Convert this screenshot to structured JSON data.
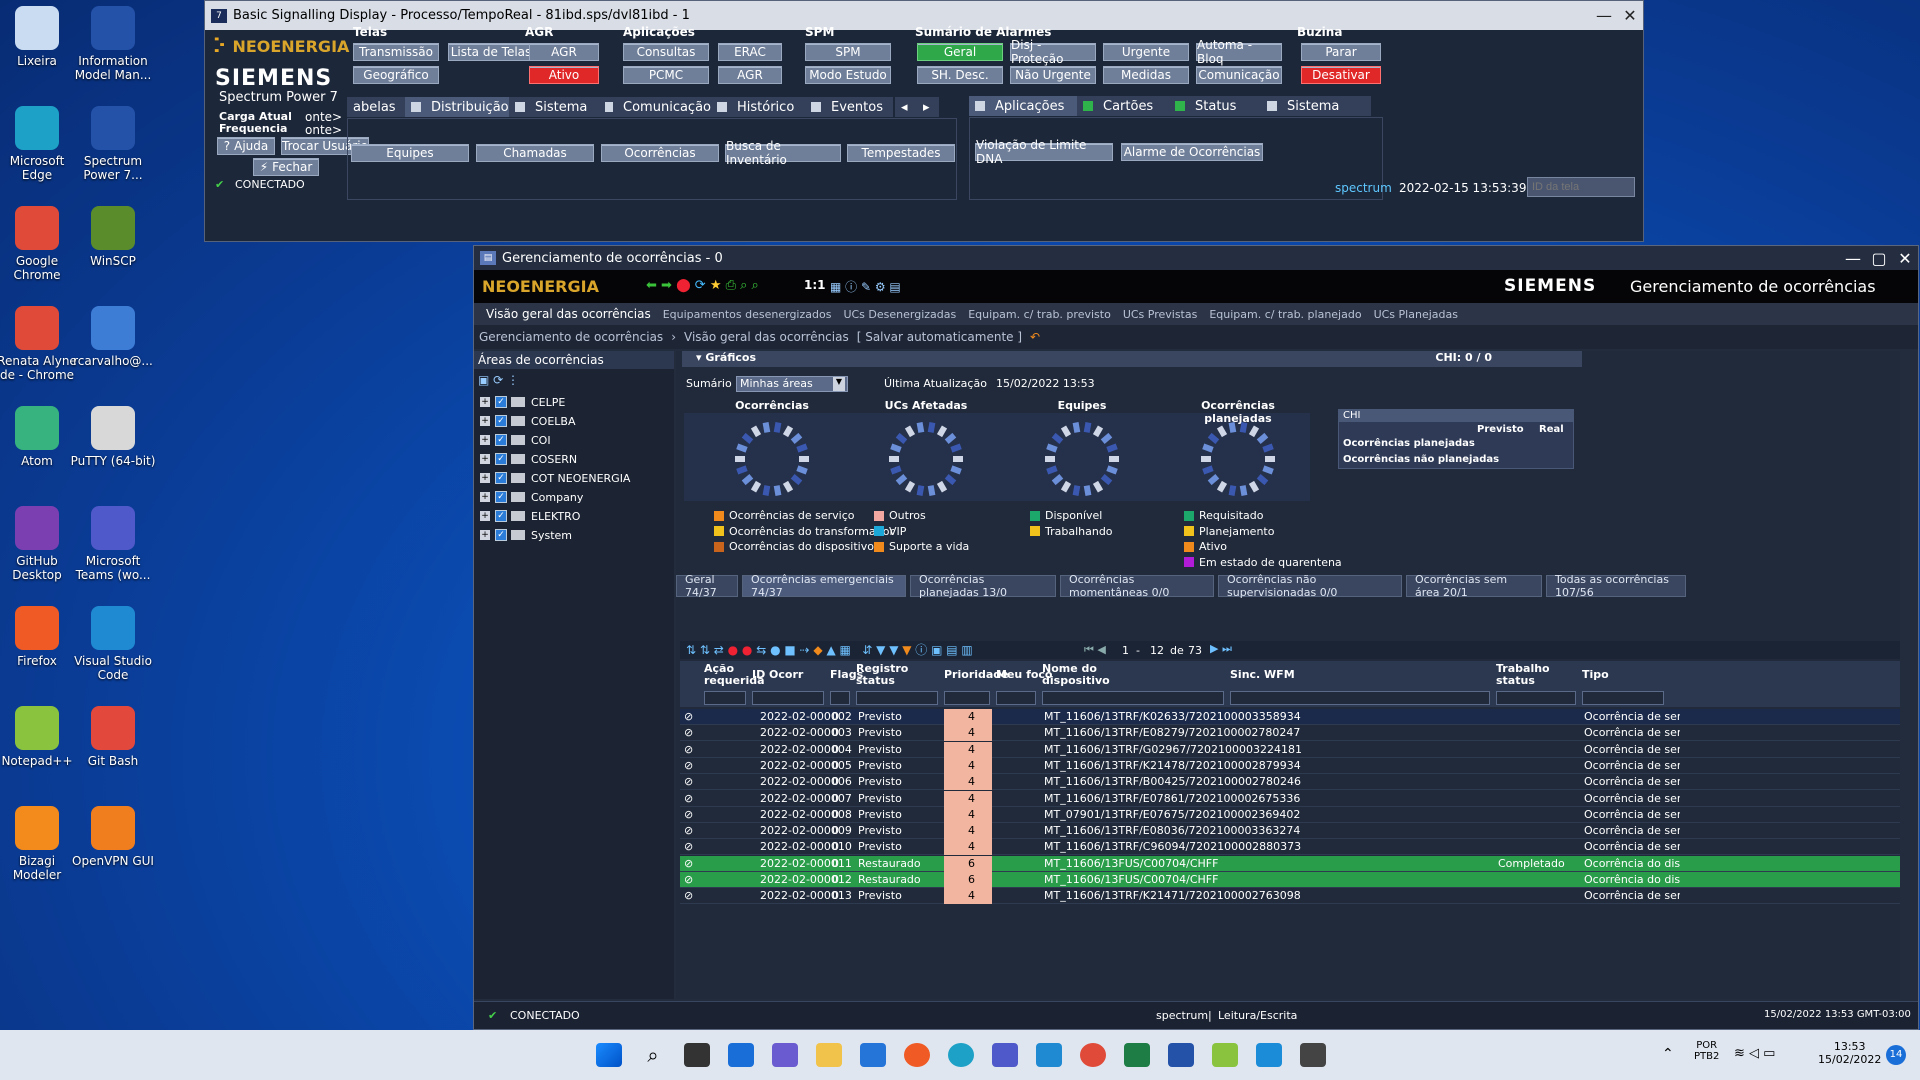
{
  "desktop": {
    "icons": [
      {
        "label": "Lixeira",
        "color": "#c9dcf2"
      },
      {
        "label": "Information Model Man...",
        "color": "#2452a8"
      },
      {
        "label": "Microsoft Edge",
        "color": "#1da1c6"
      },
      {
        "label": "Spectrum Power 7...",
        "color": "#2452a8"
      },
      {
        "label": "Google Chrome",
        "color": "#e04a38"
      },
      {
        "label": "WinSCP",
        "color": "#5a8c2c"
      },
      {
        "label": "Renata Alyne de - Chrome",
        "color": "#e04a38"
      },
      {
        "label": "rcarvalho@...",
        "color": "#3d7dd6"
      },
      {
        "label": "Atom",
        "color": "#36b37e"
      },
      {
        "label": "PuTTY (64-bit)",
        "color": "#d8d8d8"
      },
      {
        "label": "GitHub Desktop",
        "color": "#7b3fb2"
      },
      {
        "label": "Microsoft Teams (wo...",
        "color": "#5059c9"
      },
      {
        "label": "Firefox",
        "color": "#f05a24"
      },
      {
        "label": "Visual Studio Code",
        "color": "#1f8ad2"
      },
      {
        "label": "Notepad++",
        "color": "#8ac43f"
      },
      {
        "label": "Git Bash",
        "color": "#e2483b"
      },
      {
        "label": "Bizagi Modeler",
        "color": "#f28a1c"
      },
      {
        "label": "OpenVPN GUI",
        "color": "#f07e1f"
      }
    ]
  },
  "bsd": {
    "title": "Basic Signalling Display - Processo/TempoReal - 81ibd.sps/dvl81ibd - 1",
    "brand": "NEOENERGIA",
    "siemens": "SIEMENS",
    "product": "Spectrum Power 7",
    "carga": "Carga Atual",
    "freq": "Frequencia",
    "onte1": "onte>",
    "onte2": "onte>",
    "ajuda": "Ajuda",
    "trocar": "Trocar Usuário",
    "fechar": "Fechar",
    "telas": {
      "title": "Telas",
      "b1": "Transmissão",
      "b2": "Lista de Telas",
      "b3": "Geográfico"
    },
    "agr": {
      "title": "AGR",
      "b1": "AGR",
      "b2": "Ativo"
    },
    "aplic": {
      "title": "Aplicações",
      "b1": "Consultas",
      "b2": "ERAC",
      "b3": "PCMC",
      "b4": "AGR"
    },
    "spm": {
      "title": "SPM",
      "b1": "SPM",
      "b2": "Modo Estudo"
    },
    "alarmes": {
      "title": "Sumário de Alarmes",
      "b1": "Geral",
      "b2": "Disj - Proteção",
      "b3": "Urgente",
      "b4": "Automa - Bloq",
      "b5": "SH. Desc.",
      "b6": "Não Urgente",
      "b7": "Medidas",
      "b8": "Comunicação"
    },
    "buzina": {
      "title": "Buzina",
      "b1": "Parar",
      "b2": "Desativar"
    },
    "tabs": [
      "abelas",
      "Distribuição",
      "Sistema",
      "Comunicação",
      "Histórico",
      "Eventos"
    ],
    "tabs_right": [
      "Aplicações",
      "Cartões",
      "Status",
      "Sistema"
    ],
    "sub": [
      "Equipes",
      "Chamadas",
      "Ocorrências",
      "Busca de Inventário",
      "Tempestades"
    ],
    "sub_right": [
      "Violação de Limite DNA",
      "Alarme de Ocorrências"
    ],
    "status": "CONECTADO",
    "user": "spectrum",
    "datetime": "2022-02-15 13:53:39",
    "id_placeholder": "ID da tela"
  },
  "gdo": {
    "title": "Gerenciamento de ocorrências - 0",
    "brand": "NEOENERGIA",
    "siemens": "SIEMENS",
    "app": "Gerenciamento de ocorrências",
    "zoom": "1:1",
    "nav": [
      "Visão geral das ocorrências",
      "Equipamentos desenergizados",
      "UCs Desenergizadas",
      "Equipam. c/ trab. previsto",
      "UCs Previstas",
      "Equipam. c/ trab. planejado",
      "UCs Planejadas"
    ],
    "crumb1": "Gerenciamento de ocorrências",
    "crumb2": "Visão geral das ocorrências",
    "crumb3": "[ Salvar automaticamente ]",
    "areas_title": "Áreas de ocorrências",
    "areas": [
      "CELPE",
      "COELBA",
      "COI",
      "COSERN",
      "COT NEOENERGIA",
      "Company",
      "ELEKTRO",
      "System"
    ],
    "graficos": "Gráficos",
    "chi_count": "CHI: 0 / 0",
    "sumario": "Sumário",
    "sumario_value": "Minhas áreas",
    "ultima": "Última Atualização",
    "ultima_value": "15/02/2022 13:53",
    "charts": [
      "Ocorrências",
      "UCs Afetadas",
      "Equipes",
      "Ocorrências planejadas"
    ],
    "chi": {
      "title": "CHI",
      "previsto": "Previsto",
      "real": "Real",
      "r1": "Ocorrências planejadas",
      "r2": "Ocorrências não planejadas"
    },
    "legend1": [
      {
        "t": "Ocorrências de serviço",
        "c": "#f08a1c"
      },
      {
        "t": "Ocorrências do transformador",
        "c": "#f2c21c"
      },
      {
        "t": "Ocorrências do dispositivo",
        "c": "#c8641c"
      }
    ],
    "legend2": [
      {
        "t": "Outros",
        "c": "#f2a8a0"
      },
      {
        "t": "VIP",
        "c": "#1ca8d8"
      },
      {
        "t": "Suporte a vida",
        "c": "#f08a1c"
      }
    ],
    "legend3": [
      {
        "t": "Disponível",
        "c": "#1ca86a"
      },
      {
        "t": "Trabalhando",
        "c": "#f2c21c"
      }
    ],
    "legend4": [
      {
        "t": "Requisitado",
        "c": "#1ca86a"
      },
      {
        "t": "Planejamento",
        "c": "#f2c21c"
      },
      {
        "t": "Ativo",
        "c": "#f08a1c"
      },
      {
        "t": "Em estado de quarentena",
        "c": "#b21cd8"
      }
    ],
    "tabs": [
      "Geral 74/37",
      "Ocorrências emergenciais 74/37",
      "Ocorrências planejadas 13/0",
      "Ocorrências momentâneas 0/0",
      "Ocorrências não supervisionadas 0/0",
      "Ocorrências sem área 20/1",
      "Todas as ocorrências 107/56"
    ],
    "pager": {
      "from": "1",
      "sep": "-",
      "to": "12",
      "de": "de",
      "total": "73"
    },
    "columns": [
      "Ação requerida",
      "ID Ocorr",
      "Flags",
      "Registro status",
      "Prioridade",
      "Meu foco",
      "Nome do dispositivo",
      "Sinc. WFM",
      "Trabalho status",
      "Tipo"
    ],
    "rows": [
      {
        "id": "2022-02-000002",
        "flags": "0",
        "status": "Previsto",
        "prio": "4",
        "dev": "MT_11606/13TRF/K02633/7202100003358934",
        "trab": "",
        "tipo": "Ocorrência de serviço",
        "s": "b"
      },
      {
        "id": "2022-02-000003",
        "flags": "0",
        "status": "Previsto",
        "prio": "4",
        "dev": "MT_11606/13TRF/E08279/7202100002780247",
        "trab": "",
        "tipo": "Ocorrência de serviço",
        "s": ""
      },
      {
        "id": "2022-02-000004",
        "flags": "0",
        "status": "Previsto",
        "prio": "4",
        "dev": "MT_11606/13TRF/G02967/7202100003224181",
        "trab": "",
        "tipo": "Ocorrência de serviço",
        "s": ""
      },
      {
        "id": "2022-02-000005",
        "flags": "0",
        "status": "Previsto",
        "prio": "4",
        "dev": "MT_11606/13TRF/K21478/7202100002879934",
        "trab": "",
        "tipo": "Ocorrência de serviço",
        "s": ""
      },
      {
        "id": "2022-02-000006",
        "flags": "0",
        "status": "Previsto",
        "prio": "4",
        "dev": "MT_11606/13TRF/B00425/7202100002780246",
        "trab": "",
        "tipo": "Ocorrência de serviço",
        "s": ""
      },
      {
        "id": "2022-02-000007",
        "flags": "0",
        "status": "Previsto",
        "prio": "4",
        "dev": "MT_11606/13TRF/E07861/7202100002675336",
        "trab": "",
        "tipo": "Ocorrência de serviço",
        "s": ""
      },
      {
        "id": "2022-02-000008",
        "flags": "0",
        "status": "Previsto",
        "prio": "4",
        "dev": "MT_07901/13TRF/E07675/7202100002369402",
        "trab": "",
        "tipo": "Ocorrência de serviço",
        "s": ""
      },
      {
        "id": "2022-02-000009",
        "flags": "0",
        "status": "Previsto",
        "prio": "4",
        "dev": "MT_11606/13TRF/E08036/7202100003363274",
        "trab": "",
        "tipo": "Ocorrência de serviço",
        "s": ""
      },
      {
        "id": "2022-02-000010",
        "flags": "0",
        "status": "Previsto",
        "prio": "4",
        "dev": "MT_11606/13TRF/C96094/7202100002880373",
        "trab": "",
        "tipo": "Ocorrência de serviço",
        "s": ""
      },
      {
        "id": "2022-02-000011",
        "flags": "0",
        "status": "Restaurado",
        "prio": "6",
        "dev": "MT_11606/13FUS/C00704/CHFF",
        "trab": "Completado",
        "tipo": "Ocorrência do disposit",
        "s": "g"
      },
      {
        "id": "2022-02-000012",
        "flags": "0",
        "status": "Restaurado",
        "prio": "6",
        "dev": "MT_11606/13FUS/C00704/CHFF",
        "trab": "",
        "tipo": "Ocorrência do disposit",
        "s": "g"
      },
      {
        "id": "2022-02-000013",
        "flags": "0",
        "status": "Previsto",
        "prio": "4",
        "dev": "MT_11606/13TRF/K21471/7202100002763098",
        "trab": "",
        "tipo": "Ocorrência de serviço",
        "s": ""
      }
    ],
    "status": "CONECTADO",
    "user": "spectrum",
    "mode": "Leitura/Escrita",
    "datetime": "15/02/2022 13:53 GMT-03:00"
  },
  "taskbar": {
    "lang1": "POR",
    "lang2": "PTB2",
    "time": "13:53",
    "date": "15/02/2022",
    "notif": "14"
  }
}
